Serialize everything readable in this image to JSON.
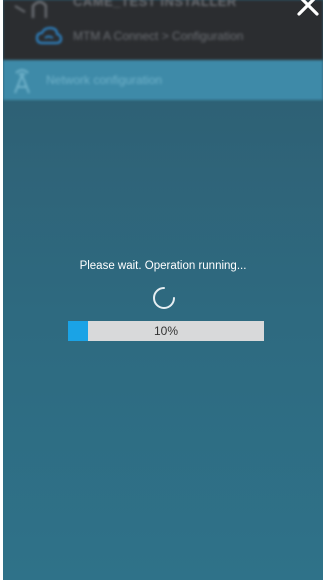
{
  "header": {
    "site_name": "CAME_TEST INSTALLER",
    "breadcrumb": "MTM A Connect > Configuration"
  },
  "section": {
    "title": "Network configuration"
  },
  "dialog": {
    "message": "Please wait. Operation running...",
    "progress_fraction": 0.1,
    "progress_label": "10%"
  },
  "icons": {
    "close": "close-icon",
    "spinner": "spinner-icon",
    "user": "user-icon",
    "cloud": "cloud-icon",
    "antenna": "antenna-icon"
  },
  "colors": {
    "progress_fill": "#1aa3e6",
    "progress_track": "#d8d9da",
    "overlay_teal": "#2f6a80"
  }
}
